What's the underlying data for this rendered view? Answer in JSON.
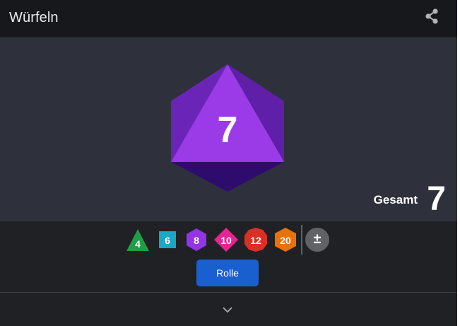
{
  "header": {
    "title": "Würfeln",
    "share_icon": "share-icon"
  },
  "stage": {
    "current_die_type": "d8",
    "current_die_value": "7",
    "total_label": "Gesamt",
    "total_value": "7",
    "die_color": "#9b3be8"
  },
  "dice_buttons": [
    {
      "label": "4",
      "shape": "triangle",
      "color": "#1e9e46"
    },
    {
      "label": "6",
      "shape": "square",
      "color": "#1aa6c4"
    },
    {
      "label": "8",
      "shape": "hexagon",
      "color": "#9334e6"
    },
    {
      "label": "10",
      "shape": "hexagon",
      "color": "#e52592"
    },
    {
      "label": "12",
      "shape": "dodecagon",
      "color": "#d93025"
    },
    {
      "label": "20",
      "shape": "hexagon",
      "color": "#e8710a"
    },
    {
      "label": "±",
      "shape": "circle",
      "color": "#5f6368"
    }
  ],
  "roll_button": {
    "label": "Rolle",
    "color": "#1a5fd0"
  },
  "footer": {
    "expand_icon": "chevron-down-icon"
  }
}
